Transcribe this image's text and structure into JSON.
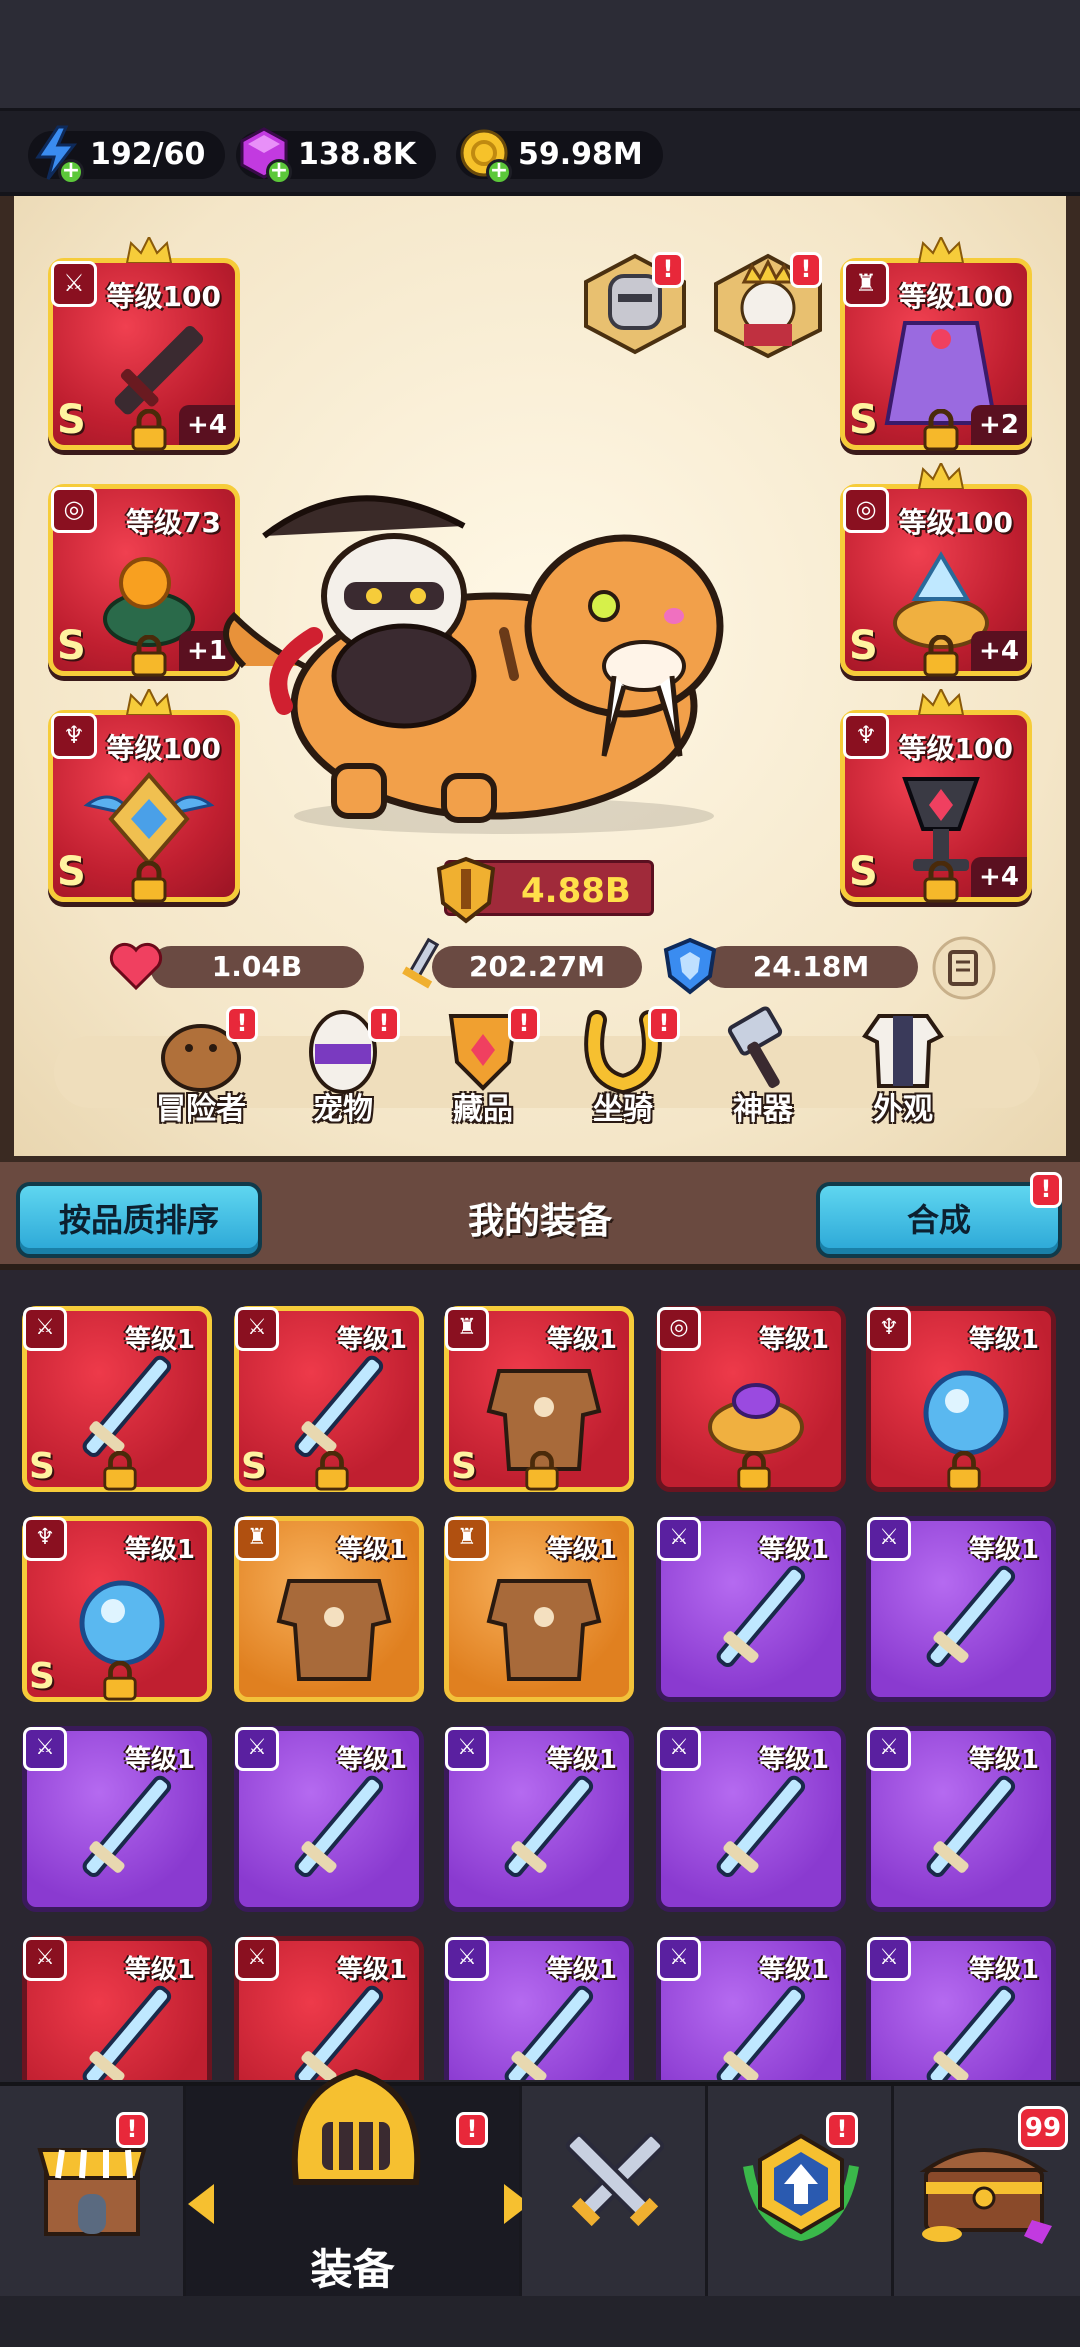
{
  "resources": {
    "energy": "192/60",
    "gems": "138.8K",
    "gold": "59.98M"
  },
  "hero": {
    "slots_left": [
      {
        "level": "等级100",
        "grade": "S",
        "plus": "+4",
        "type_icon": "sword-icon"
      },
      {
        "level": "等级73",
        "grade": "S",
        "plus": "+1",
        "type_icon": "ring-icon"
      },
      {
        "level": "等级100",
        "grade": "S",
        "plus": "",
        "type_icon": "necklace-icon"
      }
    ],
    "slots_right": [
      {
        "level": "等级100",
        "grade": "S",
        "plus": "+2",
        "type_icon": "armor-icon"
      },
      {
        "level": "等级100",
        "grade": "S",
        "plus": "+4",
        "type_icon": "ring-icon"
      },
      {
        "level": "等级100",
        "grade": "S",
        "plus": "+4",
        "type_icon": "necklace-icon"
      }
    ],
    "power": "4.88B",
    "hp": "1.04B",
    "attack": "202.27M",
    "defense": "24.18M",
    "badge": "!"
  },
  "menu": {
    "items": [
      {
        "label": "冒险者",
        "badge": "!"
      },
      {
        "label": "宠物",
        "badge": "!"
      },
      {
        "label": "藏品",
        "badge": "!"
      },
      {
        "label": "坐骑",
        "badge": "!"
      },
      {
        "label": "神器",
        "badge": ""
      },
      {
        "label": "外观",
        "badge": ""
      }
    ]
  },
  "equipment": {
    "sort_button": "按品质排序",
    "title": "我的装备",
    "merge_button": "合成",
    "merge_badge": "!",
    "items": [
      {
        "level": "等级1",
        "rarity": "red",
        "grade": "S",
        "locked": true,
        "type": "sword"
      },
      {
        "level": "等级1",
        "rarity": "red",
        "grade": "S",
        "locked": true,
        "type": "sword"
      },
      {
        "level": "等级1",
        "rarity": "red",
        "grade": "S",
        "locked": true,
        "type": "armor"
      },
      {
        "level": "等级1",
        "rarity": "red",
        "grade": "",
        "locked": true,
        "type": "ring"
      },
      {
        "level": "等级1",
        "rarity": "red",
        "grade": "",
        "locked": true,
        "type": "necklace"
      },
      {
        "level": "等级1",
        "rarity": "red",
        "grade": "S",
        "locked": true,
        "type": "necklace"
      },
      {
        "level": "等级1",
        "rarity": "orange",
        "grade": "",
        "locked": false,
        "type": "armor"
      },
      {
        "level": "等级1",
        "rarity": "orange",
        "grade": "",
        "locked": false,
        "type": "armor"
      },
      {
        "level": "等级1",
        "rarity": "purple",
        "grade": "",
        "locked": false,
        "type": "sword"
      },
      {
        "level": "等级1",
        "rarity": "purple",
        "grade": "",
        "locked": false,
        "type": "sword"
      },
      {
        "level": "等级1",
        "rarity": "purple",
        "grade": "",
        "locked": false,
        "type": "sword"
      },
      {
        "level": "等级1",
        "rarity": "purple",
        "grade": "",
        "locked": false,
        "type": "sword"
      },
      {
        "level": "等级1",
        "rarity": "purple",
        "grade": "",
        "locked": false,
        "type": "sword"
      },
      {
        "level": "等级1",
        "rarity": "purple",
        "grade": "",
        "locked": false,
        "type": "sword"
      },
      {
        "level": "等级1",
        "rarity": "purple",
        "grade": "",
        "locked": false,
        "type": "sword"
      },
      {
        "level": "等级1",
        "rarity": "red",
        "grade": "",
        "locked": false,
        "type": "sword"
      },
      {
        "level": "等级1",
        "rarity": "red",
        "grade": "",
        "locked": false,
        "type": "sword"
      },
      {
        "level": "等级1",
        "rarity": "purple",
        "grade": "",
        "locked": false,
        "type": "sword"
      },
      {
        "level": "等级1",
        "rarity": "purple",
        "grade": "",
        "locked": false,
        "type": "sword"
      },
      {
        "level": "等级1",
        "rarity": "purple",
        "grade": "",
        "locked": false,
        "type": "sword"
      }
    ]
  },
  "nav": {
    "active_label": "装备",
    "shop_badge": "!",
    "equip_badge": "!",
    "upgrade_badge": "!",
    "chest_count": "99"
  },
  "colors": {
    "legendary": "#c01f30",
    "epic": "#8a3ad0",
    "rare": "#e08020",
    "gold_border": "#f6cc3a",
    "button_blue": "#2aa6d6"
  }
}
